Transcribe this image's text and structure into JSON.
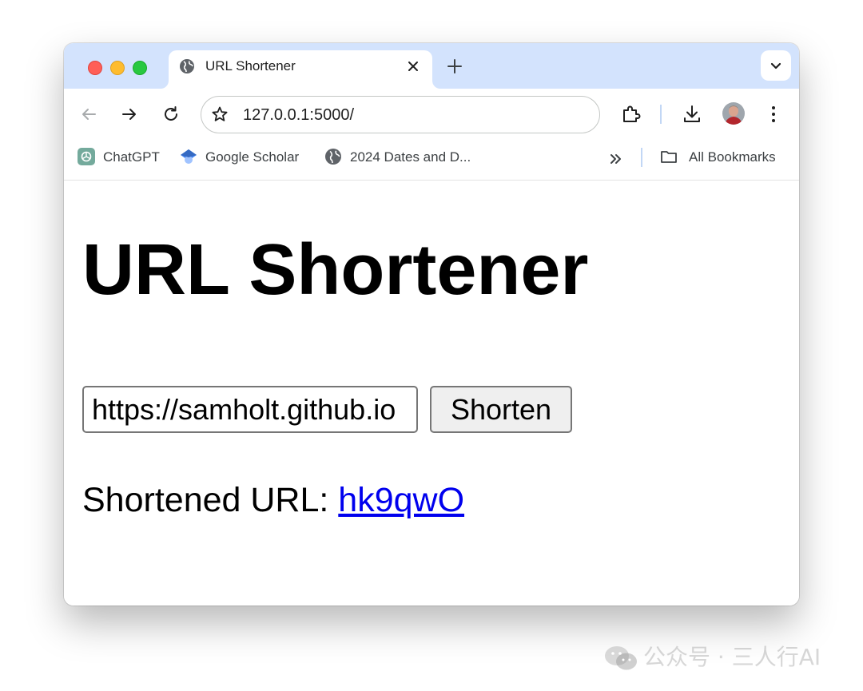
{
  "browser": {
    "tab": {
      "title": "URL Shortener"
    },
    "address_bar": {
      "url": "127.0.0.1:5000/"
    },
    "bookmarks": [
      {
        "label": "ChatGPT",
        "icon": "chatgpt-icon"
      },
      {
        "label": "Google Scholar",
        "icon": "scholar-icon"
      },
      {
        "label": "2024 Dates and D...",
        "icon": "globe-icon"
      }
    ],
    "all_bookmarks_label": "All Bookmarks"
  },
  "page": {
    "title": "URL Shortener",
    "form": {
      "url_value": "https://samholt.github.io",
      "button_label": "Shorten"
    },
    "result": {
      "label": "Shortened URL: ",
      "link_text": "hk9qwO"
    }
  },
  "watermark": {
    "text": "公众号 · 三人行AI"
  },
  "colors": {
    "tab_strip": "#d3e3fd",
    "link": "#0000ee",
    "close_light": "#ff5f57",
    "minimize_light": "#febc2e",
    "zoom_light": "#28c840"
  }
}
